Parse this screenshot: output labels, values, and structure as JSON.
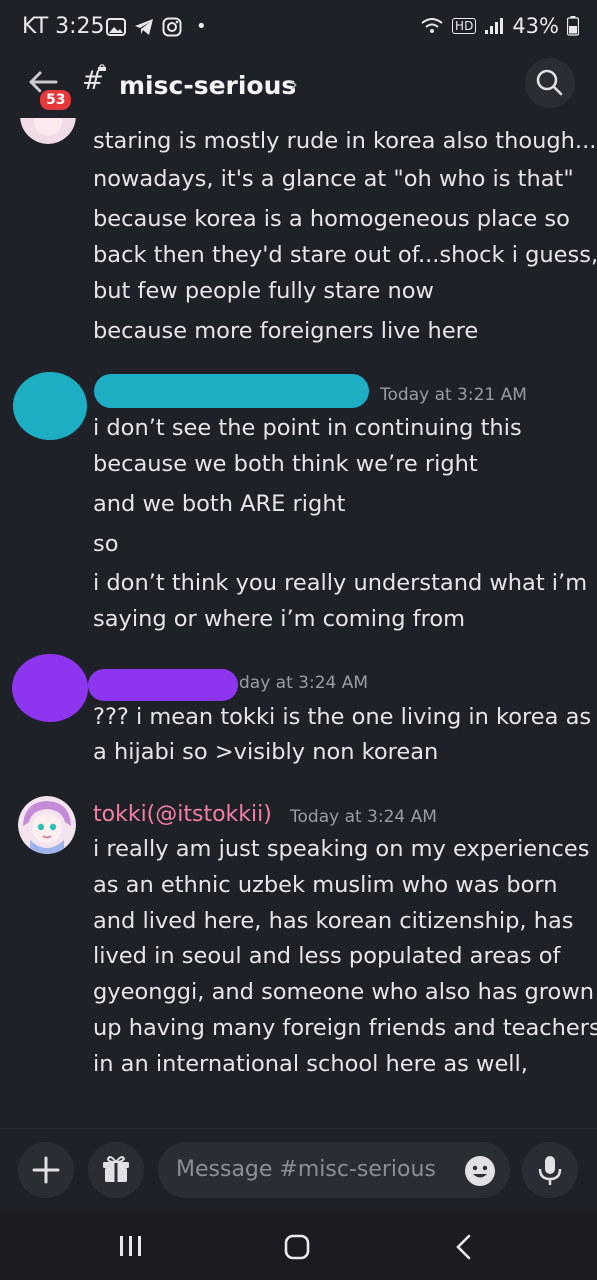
{
  "status_bar": {
    "carrier_time": "KT 3:25",
    "dot": "•",
    "hd": "HD",
    "battery": "43%"
  },
  "header": {
    "badge_count": "53",
    "hash": "#",
    "channel_name": "misc-serious",
    "chevron": "›"
  },
  "messages": [
    {
      "lines": [
        "staring is mostly rude in korea also though...",
        "nowadays, it's a glance at \"oh who is that\"",
        "because korea is a homogeneous place so",
        "back then they'd stare out of...shock i guess,",
        "but few people fully stare now",
        "because more foreigners live here"
      ]
    },
    {
      "timestamp": "Today at 3:21 AM",
      "avatar_color": "#1eaec4",
      "name_redaction_color": "#1eaec4",
      "lines": [
        "i don’t see the point in continuing this",
        "because we both think we’re right",
        "and we both ARE right",
        "so",
        "i don’t think you really understand what i’m",
        "saying or where i’m coming from"
      ]
    },
    {
      "timestamp": "day at 3:24 AM",
      "avatar_color": "#8e35f0",
      "name_redaction_color": "#8e35f0",
      "lines": [
        "??? i mean tokki is the one living in korea as",
        "a hijabi so >visibly non korean"
      ]
    },
    {
      "username": "tokki(@itstokkii)",
      "username_color": "#f47fa3",
      "timestamp": "Today at 3:24 AM",
      "lines": [
        "i really am just speaking on my experiences",
        "as an ethnic uzbek muslim who was born",
        "and lived here, has korean citizenship, has",
        "lived in seoul and less populated areas of",
        "gyeonggi, and someone who also has grown",
        "up having many foreign friends and teachers",
        "in an international school here as well,"
      ]
    }
  ],
  "composer": {
    "placeholder": "Message #misc-serious"
  },
  "icons": {
    "back": "arrow-left-icon",
    "search": "search-icon",
    "add": "plus-icon",
    "gift": "gift-icon",
    "emoji": "emoji-icon",
    "mic": "microphone-icon"
  }
}
